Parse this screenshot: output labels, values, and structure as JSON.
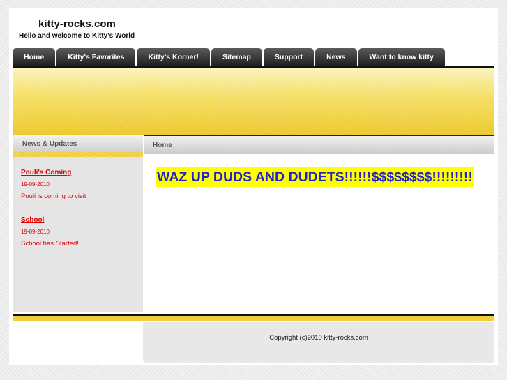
{
  "site": {
    "title": "kitty-rocks.com",
    "tagline": "Hello and welcome to Kitty's World"
  },
  "nav": {
    "items": [
      "Home",
      "Kitty's Favorites",
      "Kitty's Korner!",
      "Sitemap",
      "Support",
      "News",
      "Want to know kitty"
    ]
  },
  "sidebar": {
    "heading": "News & Updates",
    "news": [
      {
        "title": "Pouli's Coming",
        "date": "19-09-2010",
        "text": "Pouli is coming to visit"
      },
      {
        "title": "School",
        "date": "19-09-2010",
        "text": "School has Started!"
      }
    ]
  },
  "main": {
    "heading": "Home",
    "headline": "WAZ UP DUDS AND DUDETS!!!!!!$$$$$$$$!!!!!!!!!"
  },
  "footer": {
    "copyright": "Copyright (c)2010 kitty-rocks.com"
  },
  "colors": {
    "accent_yellow": "#f0cd3a",
    "nav_dark": "#1e1e1e",
    "news_red": "#e00000",
    "headline_blue": "#2222cc",
    "highlight_yellow": "#ffff00"
  }
}
